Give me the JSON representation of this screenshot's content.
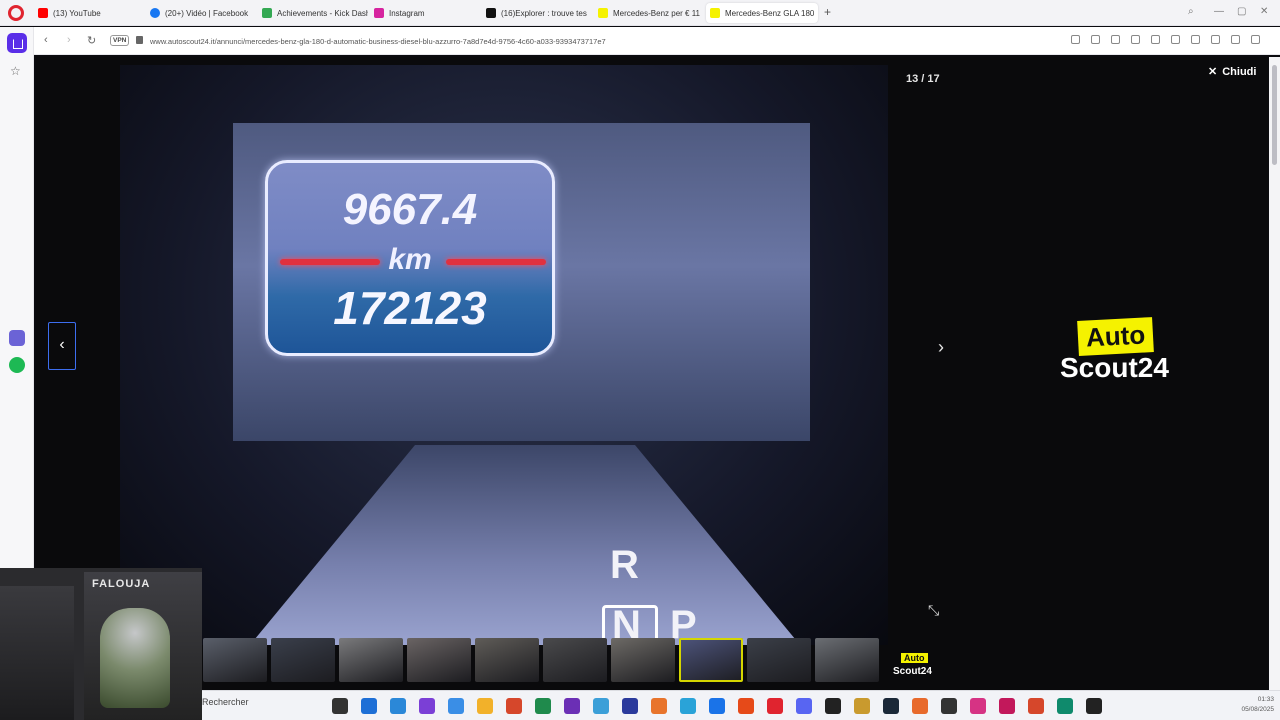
{
  "tabs": [
    {
      "label": "(13) YouTube",
      "color": "#ff0000"
    },
    {
      "label": "(20+) Vidéo | Facebook",
      "color": "#1877f2"
    },
    {
      "label": "Achievements - Kick Dash",
      "color": "#34a853"
    },
    {
      "label": "Instagram",
      "color": "#d6249f"
    },
    {
      "label": "(16)Explorer : trouve tes",
      "color": "#111111"
    },
    {
      "label": "Mercedes-Benz per € 11",
      "color": "#f5f200"
    },
    {
      "label": "Mercedes-Benz GLA 180",
      "color": "#f5f200"
    }
  ],
  "address": {
    "vpn": "VPN",
    "url": "www.autoscout24.it/annunci/mercedes-benz-gla-180-d-automatic-business-diesel-blu-azzurro-7a8d7e4d-9756-4c60-a033-9393473717e7"
  },
  "gallery": {
    "counter": "13 / 17",
    "close_label": "Chiudi",
    "odometer_trip": "9667.4",
    "odometer_unit": "km",
    "odometer_total": "172123",
    "gear_r": "R",
    "gear_n": "N",
    "gear_p": "P",
    "logo_auto": "Auto",
    "logo_scout": "Scout24"
  },
  "thumbnails": [
    {
      "color": "#5a5f6a"
    },
    {
      "color": "#3a3f4b"
    },
    {
      "color": "#7a7a7c"
    },
    {
      "color": "#6a6464"
    },
    {
      "color": "#5f5c58"
    },
    {
      "color": "#4a4a4c"
    },
    {
      "color": "#6d6a66"
    },
    {
      "color": "#4e557d",
      "active": true
    },
    {
      "color": "#3b3f48"
    },
    {
      "color": "#6b6e73"
    }
  ],
  "webcam": {
    "brand": "FALOUJA"
  },
  "taskbar": {
    "search_placeholder": "Rechercher",
    "time": "01:33",
    "date": "05/08/2025",
    "icons": [
      "#333333",
      "#1e6fd6",
      "#2b88d8",
      "#7b3fd6",
      "#3a8ee6",
      "#f2b12a",
      "#d6472b",
      "#1f8a4c",
      "#6b2fb5",
      "#3c9fd8",
      "#2b3a9c",
      "#e8742c",
      "#2aa3d8",
      "#1a73e8",
      "#e64a19",
      "#e0242f",
      "#5865f2",
      "#222222",
      "#c99a2e",
      "#1b2838",
      "#e86a2c",
      "#333333",
      "#d63384",
      "#c2185b",
      "#d6472b",
      "#0f8a6c",
      "#222222"
    ]
  }
}
